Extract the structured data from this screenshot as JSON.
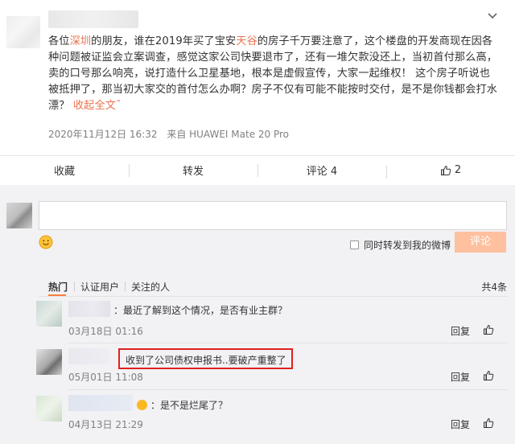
{
  "post": {
    "text_parts": {
      "p1": "各位",
      "hl1": "深圳",
      "p2": "的朋友，谁在2019年买了宝安",
      "hl2": "天谷",
      "p3": "的房子千万要注意了，这个楼盘的开发商现在因各种问题被证监会立案调查，感觉这家公司快要退市了，还有一堆欠款没还上，当初首付那么高，卖的口号那么响亮，说打造什么卫星基地，根本是虚假宣传，大家一起维权！ 这个房子听说也被抵押了，那当初大家交的首付怎么办啊？房子不仅有可能不能按时交付，是不是你钱都会打水漂？",
      "collapse": "收起全文",
      "collapse_arrow": "ˆ"
    },
    "timestamp": "2020年11月12日 16:32",
    "source": "来自 HUAWEI Mate 20 Pro"
  },
  "actions": {
    "favorite": "收藏",
    "forward": "转发",
    "comment": "评论 4",
    "like_count": "2"
  },
  "composer": {
    "forward_option": "同时转发到我的微博",
    "submit": "评论"
  },
  "tabs": {
    "hot": "热门",
    "verified": "认证用户",
    "following": "关注的人",
    "total": "共4条"
  },
  "comments": [
    {
      "text": "：最近了解到这个情况，是否有业主群？",
      "time": "03月18日 01:16",
      "reply": "回复"
    },
    {
      "text": "收到了公司债权申报书..要破产重整了",
      "time": "05月01日 11:08",
      "reply": "回复"
    },
    {
      "text": "：是不是烂尾了？",
      "time": "04月13日 21:29",
      "reply": "回复"
    }
  ],
  "colors": {
    "accent": "#eb7350",
    "submit_bg": "#ffc09f",
    "highlight_box": "#e02020"
  }
}
